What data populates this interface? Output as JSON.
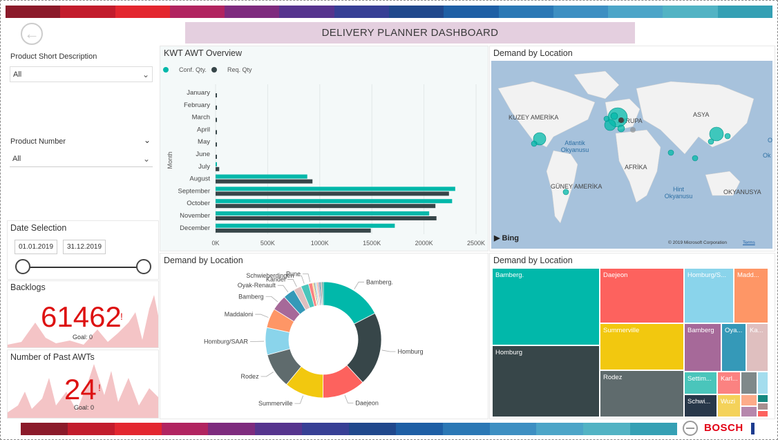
{
  "title": "DELIVERY PLANNER DASHBOARD",
  "colors": {
    "teal": "#01b8aa",
    "dark": "#374649",
    "accent_red": "#d11",
    "title_bg": "#e4cfdf"
  },
  "filters": {
    "product_short_desc": {
      "label": "Product Short Description",
      "value": "All"
    },
    "product_number": {
      "label": "Product Number",
      "value": "All"
    }
  },
  "date_selection": {
    "label": "Date Selection",
    "start": "01.01.2019",
    "end": "31.12.2019"
  },
  "backlogs": {
    "label": "Backlogs",
    "value": "61462",
    "goal": "Goal: 0"
  },
  "past_awts": {
    "label": "Number of Past AWTs",
    "value": "24",
    "goal": "Goal: 0"
  },
  "bar_panel_title": "KWT AWT Overview",
  "map_panel_title": "Demand by Location",
  "donut_panel_title": "Demand by Location",
  "treemap_panel_title": "Demand by Location",
  "map": {
    "labels": {
      "north_america": "KUZEY AMERİKA",
      "europe": "AVRUPA",
      "asia": "ASYA",
      "atlantic": "Atlantik Okyanusu",
      "africa": "AFRİKA",
      "south_america": "GÜNEY AMERİKA",
      "indian": "Hint Okyanusu",
      "oceania": "OKYANUSYA",
      "edge_o": "O",
      "edge_ok": "Ok"
    },
    "bing": "Bing",
    "copyright": "© 2019 Microsoft Corporation",
    "terms": "Terms"
  },
  "chart_data": [
    {
      "type": "bar",
      "title": "KWT AWT Overview",
      "ylabel": "Month",
      "categories": [
        "January",
        "February",
        "March",
        "April",
        "May",
        "June",
        "July",
        "August",
        "September",
        "October",
        "November",
        "December"
      ],
      "series": [
        {
          "name": "Conf. Qty.",
          "color": "#01b8aa",
          "values": [
            0,
            0,
            0,
            0,
            0,
            0,
            5000,
            880000,
            2300000,
            2270000,
            2050000,
            1720000
          ]
        },
        {
          "name": "Req. Qty",
          "color": "#374649",
          "values": [
            8000,
            8000,
            6000,
            6000,
            6000,
            6000,
            35000,
            930000,
            2240000,
            2110000,
            2120000,
            1490000
          ]
        }
      ],
      "xlim": [
        0,
        2500000
      ],
      "xticks": [
        "0K",
        "500K",
        "1000K",
        "1500K",
        "2000K",
        "2500K"
      ],
      "legend": "top-left"
    },
    {
      "type": "pie",
      "title": "Demand by Location",
      "categories": [
        "Bamberg.",
        "Homburg",
        "Daejeon",
        "Summerville",
        "Rodez",
        "Homburg/SAAR",
        "Maddaloni",
        "Bamberg",
        "Oyak-Renault",
        "Kandel",
        "Schwieberdingen",
        "Pune"
      ],
      "values": [
        16,
        19,
        11,
        10,
        9,
        7,
        5,
        4,
        3,
        2,
        2,
        1
      ],
      "colors": [
        "#01b8aa",
        "#374649",
        "#fd625e",
        "#f2c80f",
        "#5f6b6d",
        "#8ad4eb",
        "#fe9666",
        "#a66999",
        "#3599b8",
        "#dfbfbf",
        "#4ac5bb",
        "#fb8281"
      ],
      "extra_colors": [
        "#f4d25a",
        "#7f898a",
        "#a4ddee",
        "#fdab89",
        "#b687ac",
        "#28738a",
        "#a78f8f",
        "#168980"
      ]
    },
    {
      "type": "treemap",
      "title": "Demand by Location",
      "labels": [
        "Bamberg.",
        "Homburg",
        "Daejeon",
        "Summerville",
        "Rodez",
        "Homburg/S...",
        "Madd...",
        "Bamberg",
        "Oya...",
        "Ka...",
        "Settim...",
        "Karl...",
        "Schwi...",
        "Wuzi"
      ]
    }
  ]
}
